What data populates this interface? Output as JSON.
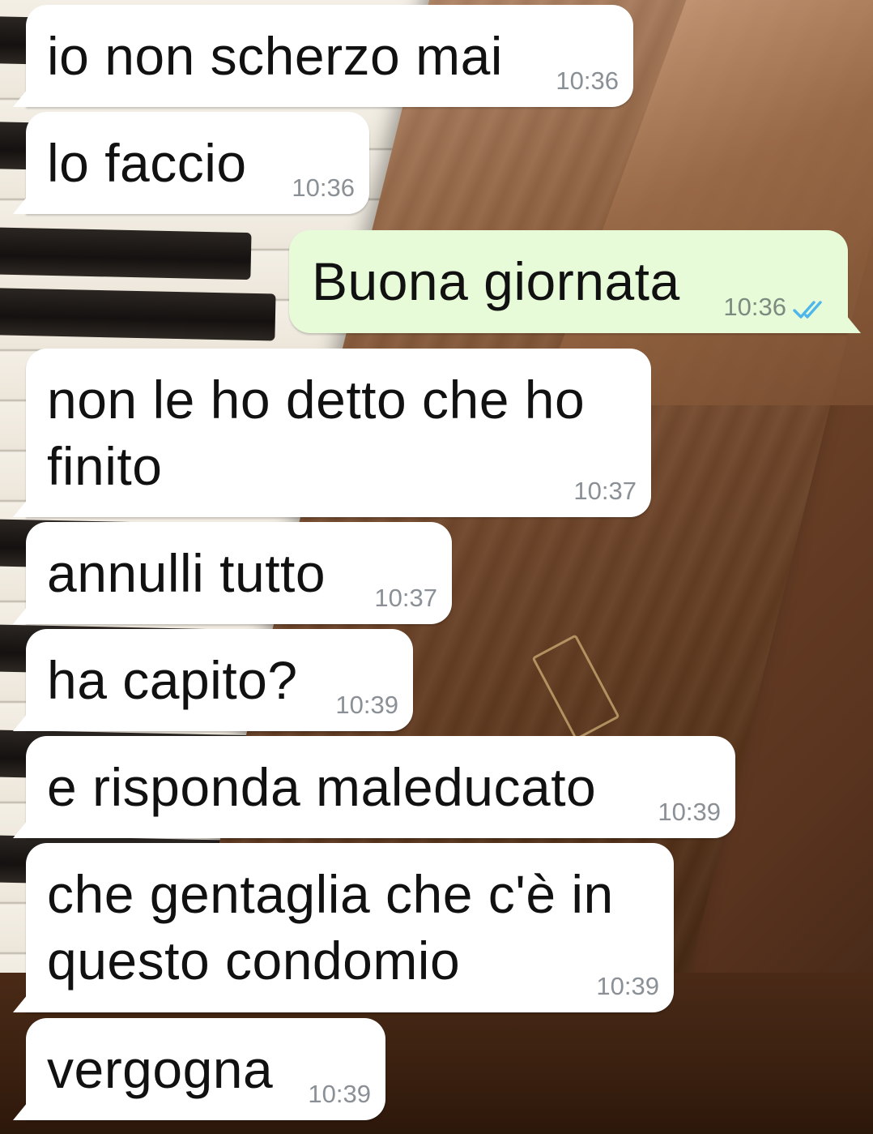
{
  "conversation": {
    "messages": [
      {
        "direction": "incoming",
        "text": "io non scherzo mai",
        "time": "10:36"
      },
      {
        "direction": "incoming",
        "text": "lo faccio",
        "time": "10:36"
      },
      {
        "direction": "outgoing",
        "text": "Buona giornata",
        "time": "10:36",
        "status": "read"
      },
      {
        "direction": "incoming",
        "text": "non le ho detto che ho\nfinito",
        "time": "10:37"
      },
      {
        "direction": "incoming",
        "text": "annulli tutto",
        "time": "10:37"
      },
      {
        "direction": "incoming",
        "text": "ha capito?",
        "time": "10:39"
      },
      {
        "direction": "incoming",
        "text": "e risponda maleducato",
        "time": "10:39"
      },
      {
        "direction": "incoming",
        "text": "che gentaglia che c'è in\nquesto condomio",
        "time": "10:39"
      },
      {
        "direction": "incoming",
        "text": "vergogna",
        "time": "10:39"
      }
    ]
  },
  "colors": {
    "incoming_bubble": "#ffffff",
    "outgoing_bubble": "#e7fbd9",
    "timestamp": "#8a9095",
    "read_ticks": "#4fb6ec"
  },
  "icons": {
    "read_receipt": "double-check-icon"
  }
}
